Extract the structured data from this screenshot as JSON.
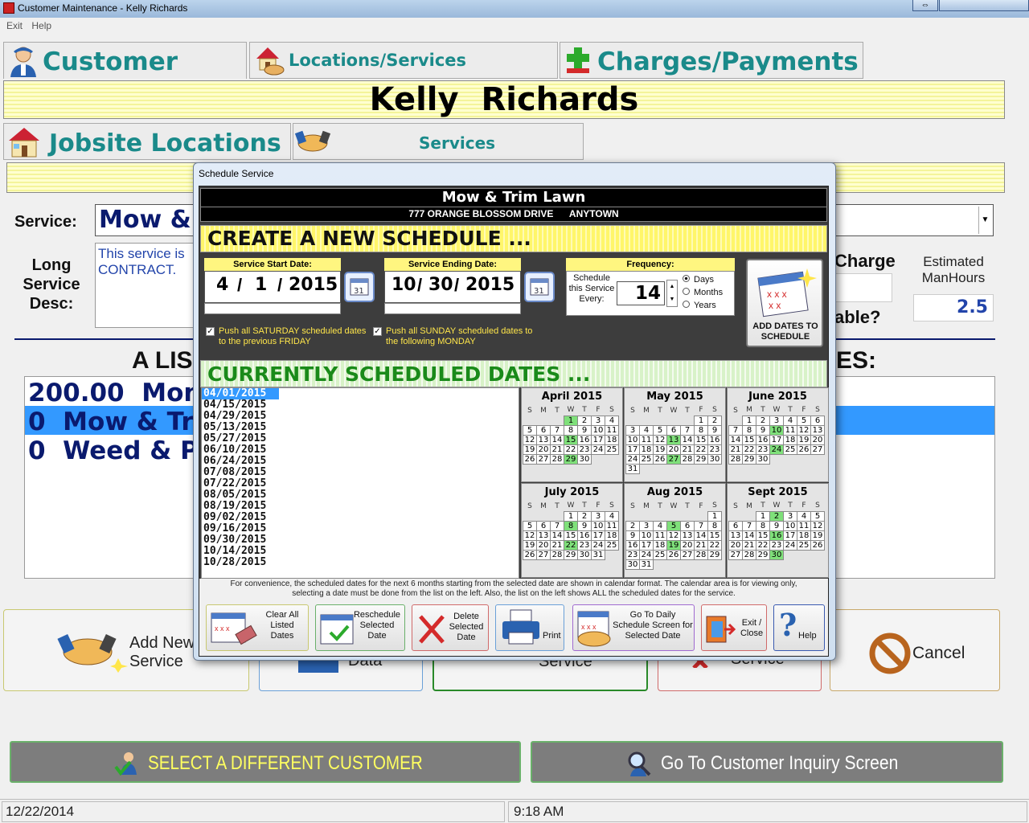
{
  "window": {
    "title": "Customer Maintenance  -  Kelly  Richards"
  },
  "menu": [
    "Exit",
    "Help"
  ],
  "tabs": {
    "customer_data": "Customer Data",
    "locations_services": "Locations/Services",
    "charges_payments": "Charges/Payments"
  },
  "customer_name": "Kelly  Richards",
  "subtabs": {
    "jobsite_locations": "Jobsite Locations",
    "services": "Services"
  },
  "address_bar": "777 Orange Blossom Drive       Anytown",
  "service": {
    "label": "Service:",
    "value": "Mow &",
    "long_desc_label": "Long Service Desc:",
    "long_desc_value": "This service is\nCONTRACT.",
    "charge_label": "Charge",
    "est_manhours_label": "Estimated ManHours",
    "est_manhours_value": "2.5",
    "taxable_label": "able?"
  },
  "list_header": {
    "left": "A LIS",
    "right": "ES:"
  },
  "service_list": [
    {
      "amount": "200.00",
      "name": "Mon"
    },
    {
      "amount": "0",
      "name": "Mow & Tri"
    },
    {
      "amount": "0",
      "name": "Weed & P"
    }
  ],
  "bottom_buttons": {
    "add_new_service": "Add New Service",
    "hidden1": "Data",
    "hidden2": "Service",
    "hidden3": "Service",
    "cancel": "Cancel"
  },
  "wide_buttons": {
    "select_customer": "SELECT A DIFFERENT CUSTOMER",
    "inquiry": "Go To Customer Inquiry Screen"
  },
  "status": {
    "date": "12/22/2014",
    "time": "9:18 AM"
  },
  "modal": {
    "title": "Schedule Service",
    "service_name": "Mow & Trim Lawn",
    "address": "777 ORANGE BLOSSOM DRIVE      ANYTOWN",
    "create_header": "CREATE A NEW SCHEDULE ...",
    "start_label": "Service Start Date:",
    "start_month": "4",
    "start_day": "1",
    "start_year": "2015",
    "end_label": "Service Ending Date:",
    "end_month": "10",
    "end_day": "30",
    "end_year": "2015",
    "frequency_label": "Frequency:",
    "schedule_every_label": "Schedule this Service Every:",
    "frequency_value": "14",
    "freq_options": [
      "Days",
      "Months",
      "Years"
    ],
    "freq_selected": "Days",
    "add_dates_label": "ADD DATES TO SCHEDULE",
    "push_saturday": "Push all SATURDAY scheduled dates to the previous FRIDAY",
    "push_sunday": "Push all SUNDAY scheduled dates to the following MONDAY",
    "current_header": "CURRENTLY SCHEDULED DATES ...",
    "scheduled_dates": [
      "04/01/2015",
      "04/15/2015",
      "04/29/2015",
      "05/13/2015",
      "05/27/2015",
      "06/10/2015",
      "06/24/2015",
      "07/08/2015",
      "07/22/2015",
      "08/05/2015",
      "08/19/2015",
      "09/02/2015",
      "09/16/2015",
      "09/30/2015",
      "10/14/2015",
      "10/28/2015"
    ],
    "selected_date": "04/01/2015",
    "note": "For convenience, the scheduled dates for the next 6 months starting from the selected date are shown in calendar format.  The calendar area is for viewing only, selecting a date must be done from the list on the left.  Also, the list on the left shows ALL the scheduled dates for the service.",
    "buttons": {
      "clear_all": "Clear All Listed Dates",
      "reschedule": "Reschedule Selected Date",
      "delete": "Delete Selected Date",
      "print": "Print",
      "go_daily": "Go To Daily Schedule Screen for Selected Date",
      "exit": "Exit / Close",
      "help": "Help"
    },
    "calendars": [
      {
        "name": "April 2015",
        "start": 3,
        "days": 30,
        "green": [
          1,
          15,
          29
        ]
      },
      {
        "name": "May 2015",
        "start": 5,
        "days": 31,
        "green": [
          13,
          27
        ]
      },
      {
        "name": "June 2015",
        "start": 1,
        "days": 30,
        "green": [
          10,
          24
        ]
      },
      {
        "name": "July 2015",
        "start": 3,
        "days": 31,
        "green": [
          8,
          22
        ]
      },
      {
        "name": "Aug 2015",
        "start": 6,
        "days": 31,
        "green": [
          5,
          19
        ]
      },
      {
        "name": "Sept 2015",
        "start": 2,
        "days": 30,
        "green": [
          2,
          16,
          30
        ]
      }
    ],
    "weekday_letters": [
      "S",
      "M",
      "T",
      "W",
      "T",
      "F",
      "S"
    ]
  }
}
